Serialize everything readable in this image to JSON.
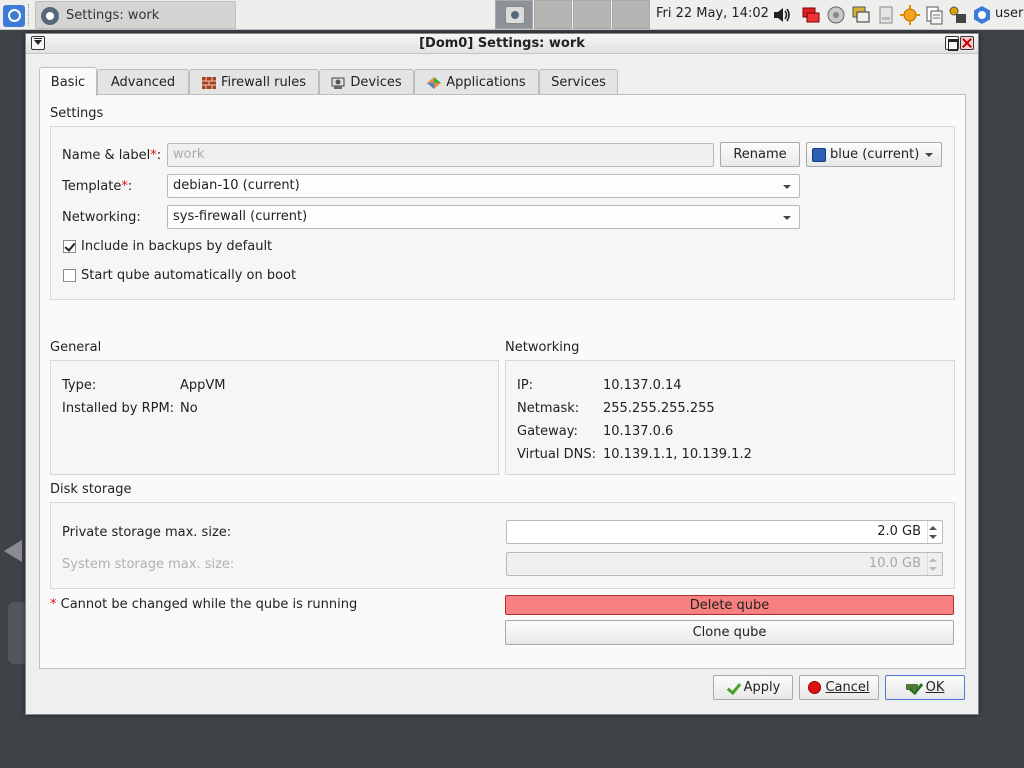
{
  "taskbar": {
    "window_title": "Settings: work",
    "clock": "Fri 22 May, 14:02",
    "user": "user"
  },
  "window": {
    "title": "[Dom0] Settings: work"
  },
  "tabs": [
    {
      "label": "Basic"
    },
    {
      "label": "Advanced"
    },
    {
      "label": "Firewall rules"
    },
    {
      "label": "Devices"
    },
    {
      "label": "Applications"
    },
    {
      "label": "Services"
    }
  ],
  "settings": {
    "section_title": "Settings",
    "name_label": "Name & label",
    "required_mark": "*",
    "colon": ":",
    "name_value": "work",
    "rename_label": "Rename",
    "label_select": "blue (current)",
    "label_color": "#2a5fb5",
    "template_label": "Template",
    "template_value": "debian-10 (current)",
    "networking_label": "Networking:",
    "networking_value": "sys-firewall (current)",
    "backup_label": "Include in backups by default",
    "backup_checked": true,
    "autostart_label": "Start qube automatically on boot",
    "autostart_checked": false
  },
  "general": {
    "section_title": "General",
    "type_label": "Type:",
    "type_value": "AppVM",
    "rpm_label": "Installed by RPM:",
    "rpm_value": "No"
  },
  "networking": {
    "section_title": "Networking",
    "ip_label": "IP:",
    "ip_value": "10.137.0.14",
    "netmask_label": "Netmask:",
    "netmask_value": "255.255.255.255",
    "gateway_label": "Gateway:",
    "gateway_value": "10.137.0.6",
    "dns_label": "Virtual DNS:",
    "dns_value": "10.139.1.1, 10.139.1.2"
  },
  "disk": {
    "section_title": "Disk storage",
    "private_label": "Private storage max. size:",
    "private_value": "2.0 GB",
    "system_label": "System storage max. size:",
    "system_value": "10.0 GB"
  },
  "notes": {
    "required_note": "Cannot be changed while the qube is running"
  },
  "actions": {
    "delete_label": "Delete qube",
    "delete_color": "#f88080",
    "clone_label": "Clone qube"
  },
  "footer": {
    "apply_label": "Apply",
    "cancel_label": "Cancel",
    "ok_label": "OK"
  }
}
